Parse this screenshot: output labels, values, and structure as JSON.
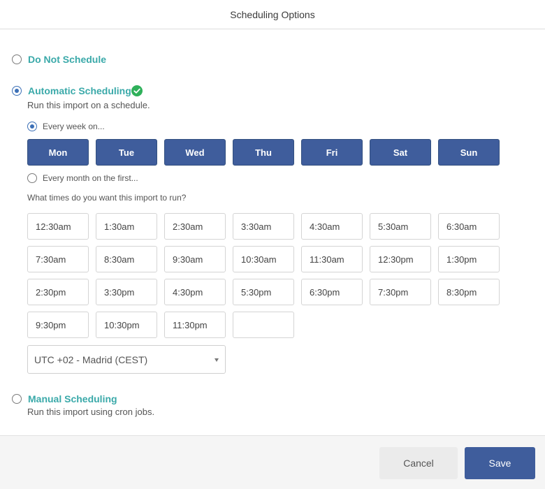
{
  "dialog": {
    "title": "Scheduling Options"
  },
  "options": {
    "do_not_schedule": {
      "label": "Do Not Schedule",
      "selected": false
    },
    "automatic": {
      "label": "Automatic Scheduling",
      "selected": true,
      "description": "Run this import on a schedule.",
      "status_icon": "check-circle-icon",
      "every_week_label": "Every week on...",
      "every_week_selected": true,
      "days": [
        "Mon",
        "Tue",
        "Wed",
        "Thu",
        "Fri",
        "Sat",
        "Sun"
      ],
      "every_month_label": "Every month on the first...",
      "every_month_selected": false,
      "times_prompt": "What times do you want this import to run?",
      "times": [
        "12:30am",
        "1:30am",
        "2:30am",
        "3:30am",
        "4:30am",
        "5:30am",
        "6:30am",
        "7:30am",
        "8:30am",
        "9:30am",
        "10:30am",
        "11:30am",
        "12:30pm",
        "1:30pm",
        "2:30pm",
        "3:30pm",
        "4:30pm",
        "5:30pm",
        "6:30pm",
        "7:30pm",
        "8:30pm",
        "9:30pm",
        "10:30pm",
        "11:30pm",
        ""
      ],
      "timezone": "UTC +02 - Madrid (CEST)"
    },
    "manual": {
      "label": "Manual Scheduling",
      "selected": false,
      "description": "Run this import using cron jobs."
    }
  },
  "footer": {
    "cancel_label": "Cancel",
    "save_label": "Save"
  },
  "colors": {
    "accent": "#3f5d9c",
    "title_teal": "#3aa9a9",
    "success": "#2fb05a"
  }
}
